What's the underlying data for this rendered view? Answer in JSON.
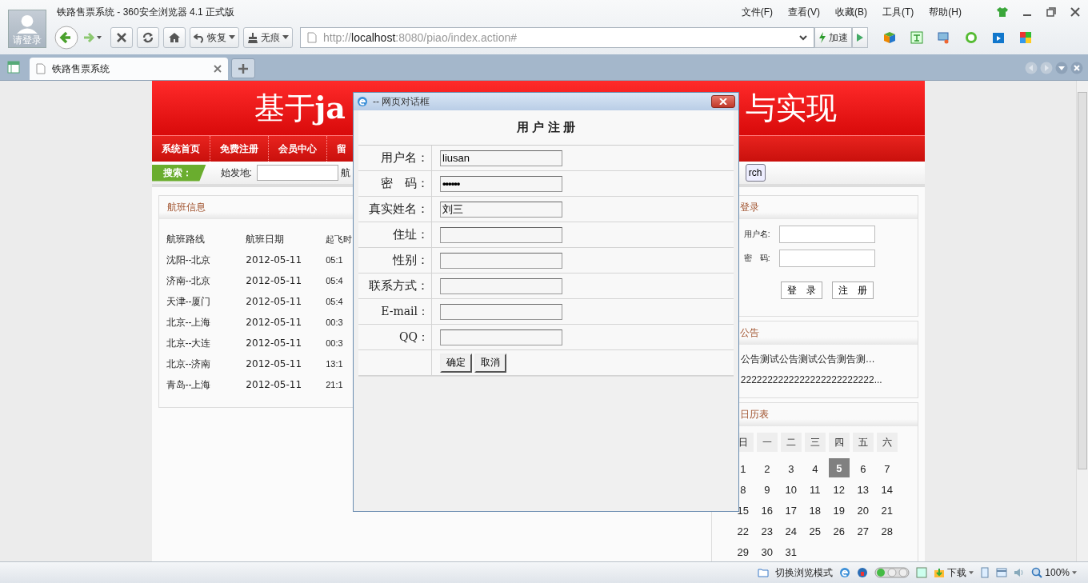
{
  "browser": {
    "title": "铁路售票系统 - 360安全浏览器 4.1 正式版",
    "login_label": "请登录",
    "menu": [
      "文件(F)",
      "查看(V)",
      "收藏(B)",
      "工具(T)",
      "帮助(H)"
    ],
    "toolbar": {
      "restore": "恢复",
      "incognito": "无痕",
      "url_scheme": "http://",
      "url_host": "localhost",
      "url_path": ":8080/piao/index.action#",
      "accelerate": "加速"
    },
    "tabs": [
      {
        "label": "铁路售票系统",
        "selected": true
      }
    ],
    "status_bar": {
      "mode": "切换浏览模式",
      "download": "下载",
      "zoom": "100%"
    }
  },
  "page": {
    "banner": {
      "title_left": "基于**ja**",
      "title_right": "与实现"
    },
    "nav": [
      "系统首页",
      "免费注册",
      "会员中心",
      "留"
    ],
    "search": {
      "label": "搜索：",
      "origin_label": "始发地:",
      "next_label": "航",
      "button": "rch"
    },
    "flights": {
      "title": "航班信息",
      "columns": [
        "航班路线",
        "航班日期",
        "起飞时"
      ],
      "rows": [
        [
          "沈阳--北京",
          "2012-05-11",
          "05:1"
        ],
        [
          "济南--北京",
          "2012-05-11",
          "05:4"
        ],
        [
          "天津--厦门",
          "2012-05-11",
          "05:4"
        ],
        [
          "北京--上海",
          "2012-05-11",
          "00:3"
        ],
        [
          "北京--大连",
          "2012-05-11",
          "00:3"
        ],
        [
          "北京--济南",
          "2012-05-11",
          "13:1"
        ],
        [
          "青岛--上海",
          "2012-05-11",
          "21:1"
        ]
      ]
    },
    "login": {
      "title": "登录",
      "username_label": "用户名:",
      "password_label": "密　码:",
      "buttons": [
        "登　录",
        "注　册"
      ]
    },
    "notices": {
      "title": "公告",
      "items": [
        "公告测试公告测试公告测告测…",
        "2222222222222222222222222..."
      ]
    },
    "calendar": {
      "title": "日历表",
      "weekdays": [
        "日",
        "一",
        "二",
        "三",
        "四",
        "五",
        "六"
      ],
      "days": [
        {
          "label": "1",
          "selected": false
        },
        {
          "label": "2",
          "selected": false
        },
        {
          "label": "3",
          "selected": false
        },
        {
          "label": "4",
          "selected": false
        },
        {
          "label": "5",
          "selected": true
        },
        {
          "label": "6",
          "selected": false
        },
        {
          "label": "7",
          "selected": false
        },
        {
          "label": "8",
          "selected": false
        },
        {
          "label": "9",
          "selected": false
        },
        {
          "label": "10",
          "selected": false
        },
        {
          "label": "11",
          "selected": false
        },
        {
          "label": "12",
          "selected": false
        },
        {
          "label": "13",
          "selected": false
        },
        {
          "label": "14",
          "selected": false
        },
        {
          "label": "15",
          "selected": false
        },
        {
          "label": "16",
          "selected": false
        },
        {
          "label": "17",
          "selected": false
        },
        {
          "label": "18",
          "selected": false
        },
        {
          "label": "19",
          "selected": false
        },
        {
          "label": "20",
          "selected": false
        },
        {
          "label": "21",
          "selected": false
        },
        {
          "label": "22",
          "selected": false
        },
        {
          "label": "23",
          "selected": false
        },
        {
          "label": "24",
          "selected": false
        },
        {
          "label": "25",
          "selected": false
        },
        {
          "label": "26",
          "selected": false
        },
        {
          "label": "27",
          "selected": false
        },
        {
          "label": "28",
          "selected": false
        },
        {
          "label": "29",
          "selected": false
        },
        {
          "label": "30",
          "selected": false
        },
        {
          "label": "31",
          "selected": false
        }
      ]
    }
  },
  "dialog": {
    "title": "-- 网页对话框",
    "heading": "用 户 注 册",
    "fields": [
      {
        "label": "用户名：",
        "value": "liusan",
        "kind": "text"
      },
      {
        "label": "密　码：",
        "value": "••••••",
        "kind": "password"
      },
      {
        "label": "真实姓名：",
        "value": "刘三",
        "kind": "text"
      },
      {
        "label": "住址：",
        "kind": "text"
      },
      {
        "label": "性别：",
        "kind": "text"
      },
      {
        "label": "联系方式：",
        "kind": "text"
      },
      {
        "label": "E-mail：",
        "kind": "text"
      },
      {
        "label": "QQ：",
        "kind": "text"
      }
    ],
    "buttons": [
      "确定",
      "取消"
    ]
  }
}
